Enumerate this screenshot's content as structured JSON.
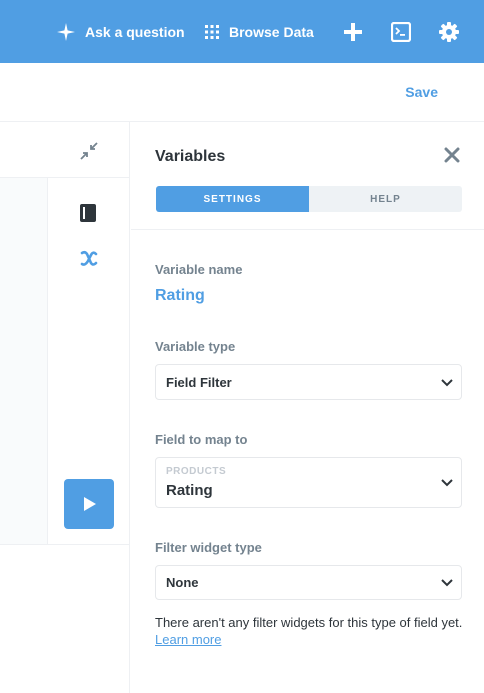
{
  "topbar": {
    "ask_label": "Ask a question",
    "browse_label": "Browse Data",
    "icons": [
      "sparkle-icon",
      "grid-icon",
      "plus-icon",
      "terminal-icon",
      "gear-icon"
    ],
    "background": "#509ee3"
  },
  "subbar": {
    "save_label": "Save"
  },
  "editor": {
    "icons": [
      "collapse-icon",
      "book-icon",
      "variable-x-icon",
      "play-icon"
    ]
  },
  "sidebar": {
    "title": "Variables",
    "tabs": [
      {
        "label": "SETTINGS",
        "active": true
      },
      {
        "label": "HELP",
        "active": false
      }
    ],
    "variable_name_label": "Variable name",
    "variable_name_value": "Rating",
    "variable_type_label": "Variable type",
    "variable_type_value": "Field Filter",
    "field_map_label": "Field to map to",
    "field_map_table": "PRODUCTS",
    "field_map_value": "Rating",
    "filter_widget_label": "Filter widget type",
    "filter_widget_value": "None",
    "note_text": "There aren't any filter widgets for this type of field yet. ",
    "note_link": "Learn more"
  },
  "colors": {
    "brand": "#509ee3",
    "text_dark": "#2e353b",
    "text_medium": "#74838f",
    "border": "#eef0f3"
  }
}
